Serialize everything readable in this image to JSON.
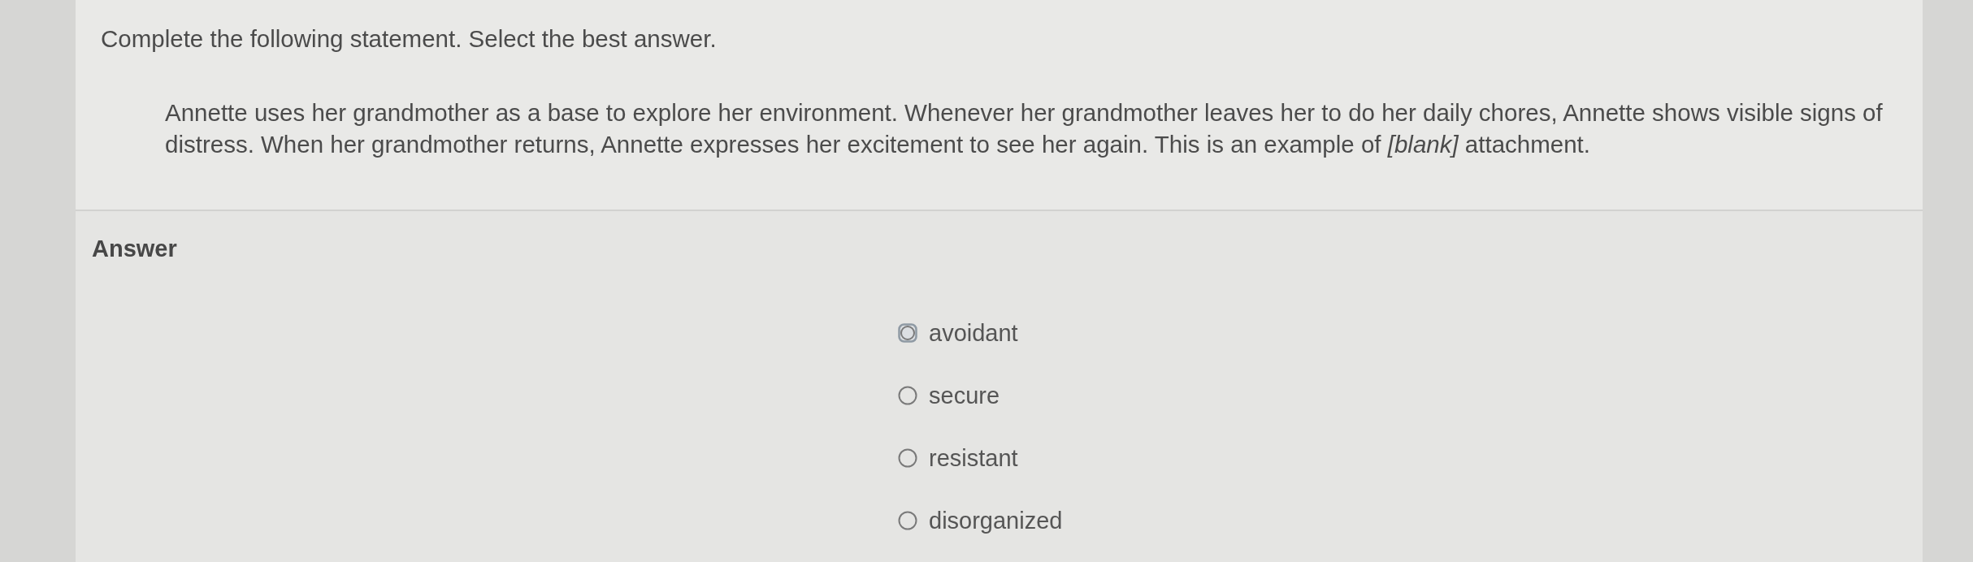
{
  "instruction": "Complete the following statement. Select the best answer.",
  "question": "Annette uses her grandmother as a base to explore her environment. Whenever her grandmother leaves her to do her daily chores, Annette shows visible signs of distress. When her grandmother returns, Annette expresses her excitement to see her again. This is an example of *[blank]* attachment.",
  "answer": {
    "heading": "Answer",
    "options": [
      {
        "label": "avoidant",
        "selected": false,
        "focused": true
      },
      {
        "label": "secure",
        "selected": false,
        "focused": false
      },
      {
        "label": "resistant",
        "selected": false,
        "focused": false
      },
      {
        "label": "disorganized",
        "selected": false,
        "focused": false
      }
    ]
  }
}
